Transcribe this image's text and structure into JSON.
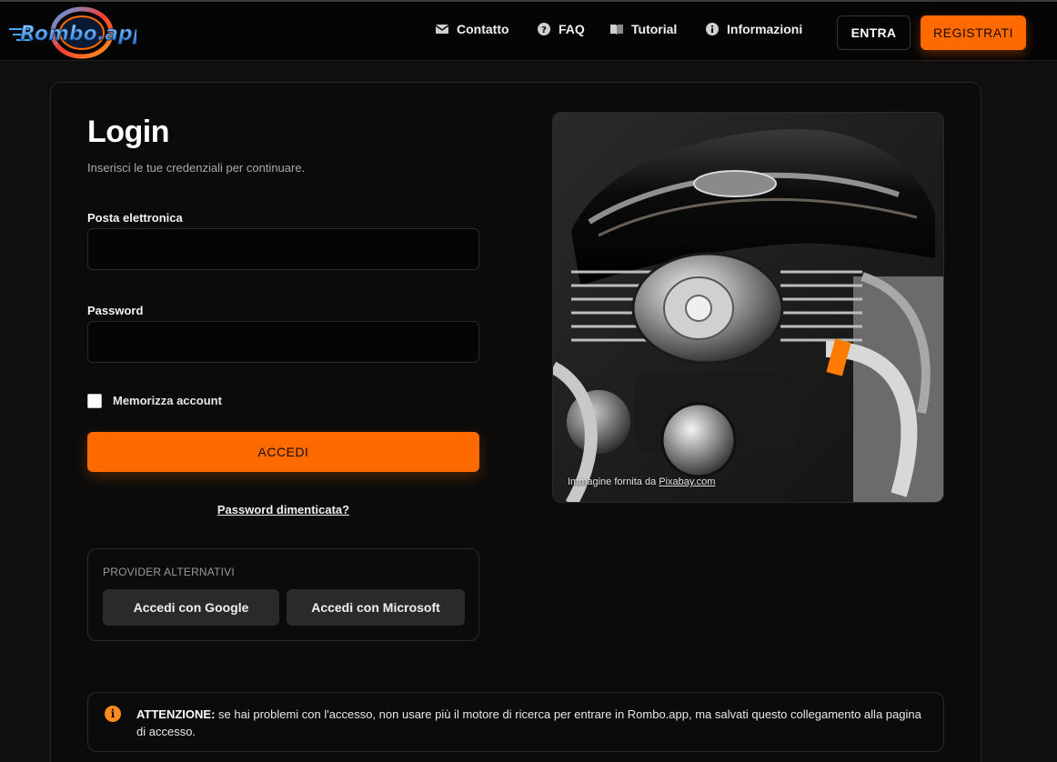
{
  "header": {
    "logo_text": "Rombo.app",
    "nav": [
      {
        "label": "Contatto",
        "icon": "envelope-icon"
      },
      {
        "label": "FAQ",
        "icon": "question-circle-icon"
      },
      {
        "label": "Tutorial",
        "icon": "book-icon"
      },
      {
        "label": "Informazioni",
        "icon": "info-circle-icon"
      }
    ],
    "login_label": "ENTRA",
    "register_label": "REGISTRATI"
  },
  "login": {
    "title": "Login",
    "subtitle": "Inserisci le tue credenziali per continuare.",
    "email_label": "Posta elettronica",
    "email_value": "",
    "password_label": "Password",
    "password_value": "",
    "remember_label": "Memorizza account",
    "remember_checked": false,
    "submit_label": "ACCEDI",
    "forgot_label": "Password dimenticata?"
  },
  "providers": {
    "title": "PROVIDER ALTERNATIVI",
    "google_label": "Accedi con Google",
    "microsoft_label": "Accedi con Microsoft"
  },
  "image": {
    "credit_prefix": "Immagine fornita da",
    "credit_link": "Pixabay.com"
  },
  "alert": {
    "strong": "ATTENZIONE:",
    "text": " se hai problemi con l'accesso, non usare più il motore di ricerca per entrare in Rombo.app, ma salvati questo collegamento alla pagina di accesso.",
    "icon": "info-icon"
  },
  "colors": {
    "accent": "#ff6a00",
    "background": "#0f0f0f",
    "panel": "#0b0b0b"
  }
}
